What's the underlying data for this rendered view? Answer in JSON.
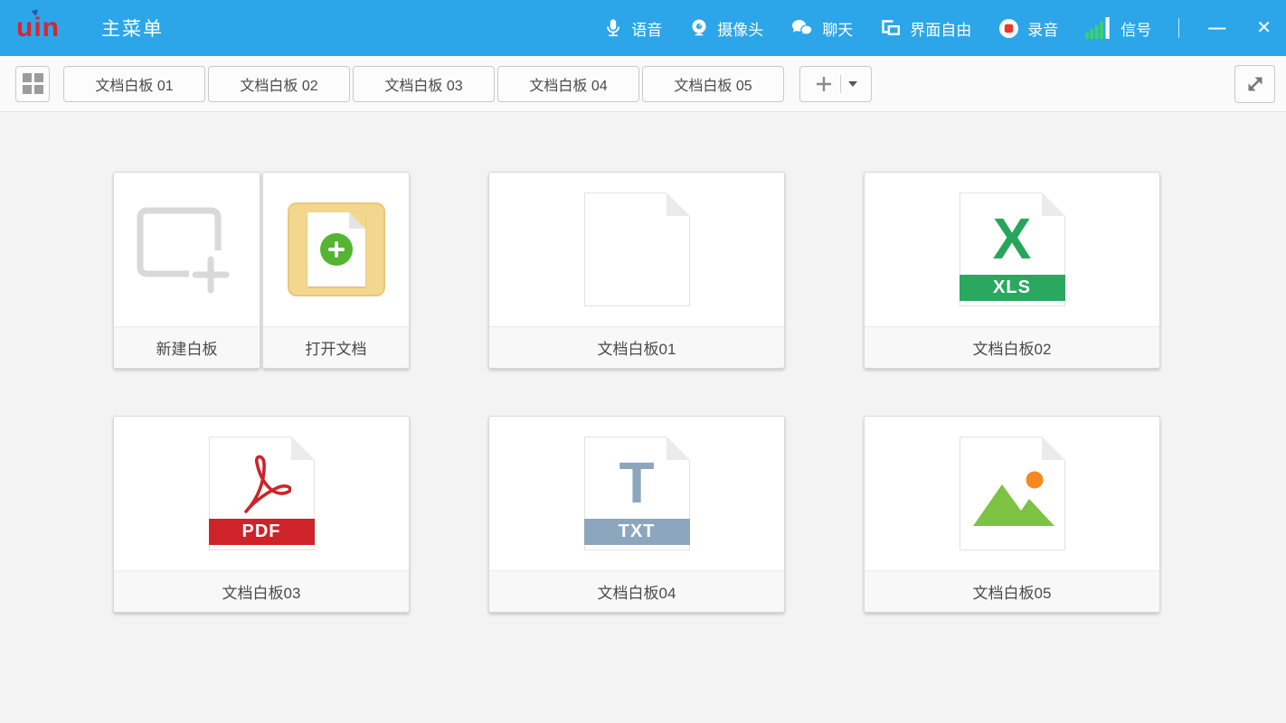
{
  "header": {
    "logo_text": "uin",
    "title": "主菜单",
    "tools": [
      {
        "label": "语音"
      },
      {
        "label": "摄像头"
      },
      {
        "label": "聊天"
      },
      {
        "label": "界面自由"
      },
      {
        "label": "录音"
      },
      {
        "label": "信号"
      }
    ],
    "minimize_glyph": "—",
    "close_glyph": "✕"
  },
  "icons": {
    "heart": "♥"
  },
  "tabbar": {
    "tabs": [
      {
        "label": "文档白板 01"
      },
      {
        "label": "文档白板 02"
      },
      {
        "label": "文档白板 03"
      },
      {
        "label": "文档白板 04"
      },
      {
        "label": "文档白板 05"
      }
    ]
  },
  "cards": {
    "new_whiteboard": {
      "label": "新建白板"
    },
    "open_document": {
      "label": "打开文档"
    },
    "documents": [
      {
        "label": "文档白板01",
        "type": "blank",
        "badge": ""
      },
      {
        "label": "文档白板02",
        "type": "xls",
        "glyph": "X",
        "badge": "XLS"
      },
      {
        "label": "文档白板03",
        "type": "pdf",
        "badge": "PDF"
      },
      {
        "label": "文档白板04",
        "type": "txt",
        "glyph": "T",
        "badge": "TXT"
      },
      {
        "label": "文档白板05",
        "type": "image",
        "badge": ""
      }
    ]
  },
  "colors": {
    "header_bg": "#2CA6E9",
    "logo_red": "#D7262C",
    "xls_green": "#2BA85F",
    "pdf_red": "#CE2328",
    "txt_slate": "#8CA6BE",
    "image_green": "#7DC242",
    "image_sun": "#F5881F",
    "open_doc_tan": "#F3D78E",
    "plus_circle_green": "#54B531",
    "record_red": "#E8392F",
    "signal_green": "#3BD65A"
  }
}
